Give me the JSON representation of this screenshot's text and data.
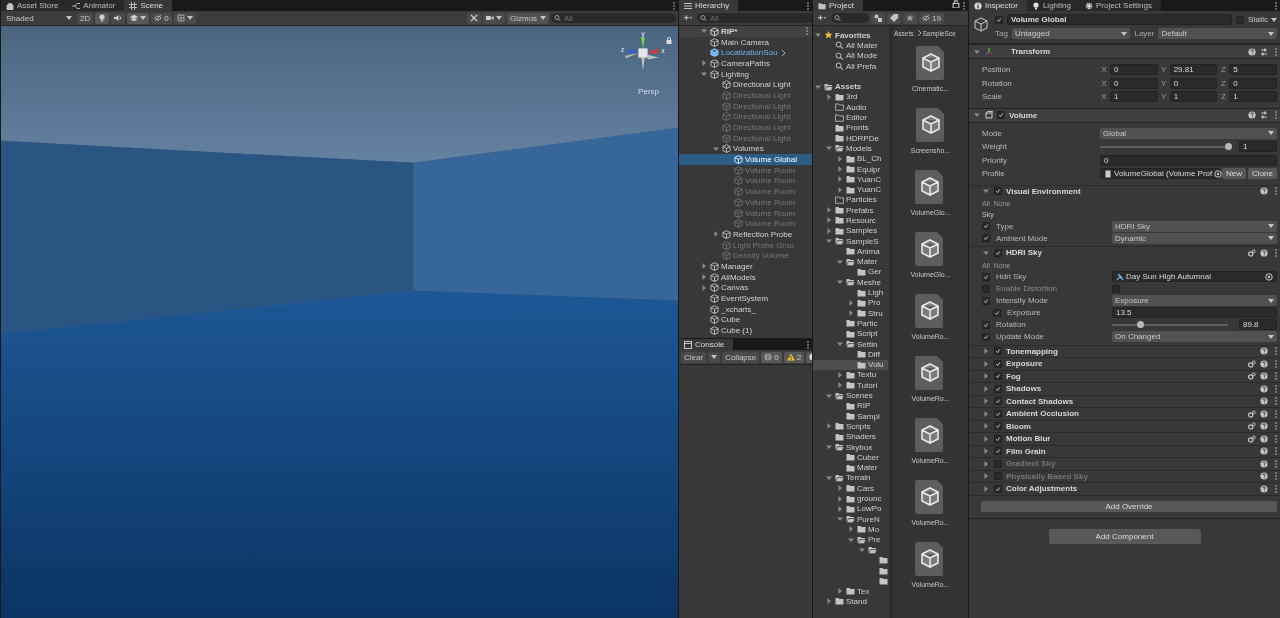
{
  "scene": {
    "tabs": [
      {
        "label": "Asset Store",
        "selected": false
      },
      {
        "label": "Animator",
        "selected": false
      },
      {
        "label": "Scene",
        "selected": true
      }
    ],
    "toolbar": {
      "shading": "Shaded",
      "mode_2d": "2D",
      "hidden_count": "0",
      "gizmos": "Gizmos",
      "search_placeholder": "All"
    },
    "gizmo": {
      "axes": [
        "y",
        "z",
        "x"
      ],
      "projection": "Persp"
    }
  },
  "hierarchy": {
    "title": "Hierarchy",
    "search_placeholder": "All",
    "scene": {
      "label": "RIP*",
      "expanded": true
    },
    "items": [
      {
        "label": "Main Camera",
        "kind": "object",
        "active": true,
        "selected": false
      },
      {
        "label": "LocalizationSou",
        "kind": "prefab",
        "active": true,
        "selected": false
      },
      {
        "label": "CameraPaths",
        "kind": "object",
        "active": true,
        "selected": false,
        "expanded": false
      },
      {
        "label": "Lighting",
        "kind": "object",
        "active": true,
        "selected": false,
        "expanded": true,
        "children": [
          {
            "label": "Directional Light",
            "kind": "object",
            "active": true,
            "selected": false
          },
          {
            "label": "Directional Light",
            "kind": "object",
            "active": false,
            "selected": false
          },
          {
            "label": "Directional Light",
            "kind": "object",
            "active": false,
            "selected": false
          },
          {
            "label": "Directional Light",
            "kind": "object",
            "active": false,
            "selected": false
          },
          {
            "label": "Directional Light",
            "kind": "object",
            "active": false,
            "selected": false
          },
          {
            "label": "Directional Light",
            "kind": "object",
            "active": false,
            "selected": false
          },
          {
            "label": "Volumes",
            "kind": "object",
            "active": true,
            "selected": false,
            "expanded": true,
            "children": [
              {
                "label": "Volume Global",
                "kind": "object",
                "active": true,
                "selected": true
              },
              {
                "label": "Volume Room",
                "kind": "object",
                "active": false,
                "selected": false
              },
              {
                "label": "Volume Room",
                "kind": "object",
                "active": false,
                "selected": false
              },
              {
                "label": "Volume Room",
                "kind": "object",
                "active": false,
                "selected": false
              },
              {
                "label": "Volume Room",
                "kind": "object",
                "active": false,
                "selected": false
              },
              {
                "label": "Volume Room",
                "kind": "object",
                "active": false,
                "selected": false
              },
              {
                "label": "Volume Room",
                "kind": "object",
                "active": false,
                "selected": false
              }
            ]
          },
          {
            "label": "Reflection Probe",
            "kind": "object",
            "active": true,
            "selected": false,
            "expanded": false
          },
          {
            "label": "Light Probe Grou",
            "kind": "object",
            "active": false,
            "selected": false
          },
          {
            "label": "Density Volume",
            "kind": "object",
            "active": false,
            "selected": false
          }
        ]
      },
      {
        "label": "Manager",
        "kind": "object",
        "active": true,
        "selected": false,
        "expanded": false
      },
      {
        "label": "AllModels",
        "kind": "object",
        "active": true,
        "selected": false,
        "expanded": false
      },
      {
        "label": "Canvas",
        "kind": "object",
        "active": true,
        "selected": false,
        "expanded": false
      },
      {
        "label": "EventSystem",
        "kind": "object",
        "active": true,
        "selected": false
      },
      {
        "label": "_xcharts_",
        "kind": "object",
        "active": true,
        "selected": false
      },
      {
        "label": "Cube",
        "kind": "object",
        "active": true,
        "selected": false
      },
      {
        "label": "Cube (1)",
        "kind": "object",
        "active": true,
        "selected": false
      }
    ]
  },
  "console": {
    "title": "Console",
    "clear": "Clear",
    "collapse": "Collapse",
    "errors": "0",
    "warnings": "2"
  },
  "project": {
    "title": "Project",
    "hidden_count": "19",
    "breadcrumb": [
      "Assets",
      "SampleSce"
    ],
    "tree": [
      {
        "label": "Favorites",
        "kind": "favorites",
        "selected": false,
        "expanded": true,
        "children": [
          {
            "label": "All Mater",
            "kind": "search",
            "selected": false
          },
          {
            "label": "All Mode",
            "kind": "search",
            "selected": false
          },
          {
            "label": "All Prefa",
            "kind": "search",
            "selected": false
          }
        ]
      },
      {
        "label": "Assets",
        "kind": "folder",
        "selected": false,
        "expanded": true,
        "children": [
          {
            "label": "3rd",
            "kind": "folder",
            "selected": false,
            "expanded": false
          },
          {
            "label": "Audio",
            "kind": "empty-folder",
            "selected": false
          },
          {
            "label": "Editor",
            "kind": "empty-folder",
            "selected": false
          },
          {
            "label": "Fronts",
            "kind": "folder",
            "selected": false
          },
          {
            "label": "HDRPDe",
            "kind": "folder",
            "selected": false
          },
          {
            "label": "Models",
            "kind": "folder",
            "selected": false,
            "expanded": true,
            "children": [
              {
                "label": "BL_Ch",
                "kind": "folder",
                "selected": false,
                "expanded": false
              },
              {
                "label": "Equipr",
                "kind": "folder",
                "selected": false,
                "expanded": false
              },
              {
                "label": "YuanC",
                "kind": "folder",
                "selected": false,
                "expanded": false
              },
              {
                "label": "YuanC",
                "kind": "folder",
                "selected": false,
                "expanded": false
              }
            ]
          },
          {
            "label": "Particles",
            "kind": "empty-folder",
            "selected": false
          },
          {
            "label": "Prefabs",
            "kind": "folder",
            "selected": false,
            "expanded": false
          },
          {
            "label": "Resourc",
            "kind": "folder",
            "selected": false,
            "expanded": false
          },
          {
            "label": "Samples",
            "kind": "folder",
            "selected": false,
            "expanded": false
          },
          {
            "label": "SampleS",
            "kind": "folder",
            "selected": false,
            "expanded": true,
            "children": [
              {
                "label": "Anima",
                "kind": "folder",
                "selected": false
              },
              {
                "label": "Mater",
                "kind": "folder",
                "selected": false,
                "expanded": true,
                "children": [
                  {
                    "label": "Ger",
                    "kind": "folder",
                    "selected": false
                  }
                ]
              },
              {
                "label": "Meshe",
                "kind": "folder",
                "selected": false,
                "expanded": true,
                "children": [
                  {
                    "label": "Ligh",
                    "kind": "folder",
                    "selected": false
                  },
                  {
                    "label": "Pro",
                    "kind": "folder",
                    "selected": false,
                    "expanded": false
                  },
                  {
                    "label": "Stru",
                    "kind": "folder",
                    "selected": false,
                    "expanded": false
                  }
                ]
              },
              {
                "label": "Partic",
                "kind": "folder",
                "selected": false
              },
              {
                "label": "Script",
                "kind": "folder",
                "selected": false
              },
              {
                "label": "Settin",
                "kind": "folder",
                "selected": false,
                "expanded": true,
                "children": [
                  {
                    "label": "Diff",
                    "kind": "folder",
                    "selected": false
                  },
                  {
                    "label": "Volu",
                    "kind": "folder",
                    "selected": true
                  }
                ]
              },
              {
                "label": "Textu",
                "kind": "folder",
                "selected": false,
                "expanded": false
              },
              {
                "label": "Tutori",
                "kind": "folder",
                "selected": false,
                "expanded": false
              }
            ]
          },
          {
            "label": "Scenes",
            "kind": "folder",
            "selected": false,
            "expanded": true,
            "children": [
              {
                "label": "RIP",
                "kind": "folder",
                "selected": false
              },
              {
                "label": "Sampl",
                "kind": "folder",
                "selected": false
              }
            ]
          },
          {
            "label": "Scripts",
            "kind": "folder",
            "selected": false,
            "expanded": false
          },
          {
            "label": "Shaders",
            "kind": "folder",
            "selected": false
          },
          {
            "label": "Skybox",
            "kind": "folder",
            "selected": false,
            "expanded": true,
            "children": [
              {
                "label": "Cuber",
                "kind": "folder",
                "selected": false
              },
              {
                "label": "Mater",
                "kind": "folder",
                "selected": false
              }
            ]
          },
          {
            "label": "Terrain",
            "kind": "folder",
            "selected": false,
            "expanded": true,
            "children": [
              {
                "label": "Cars",
                "kind": "folder",
                "selected": false,
                "expanded": false
              },
              {
                "label": "grounc",
                "kind": "folder",
                "selected": false,
                "expanded": false
              },
              {
                "label": "LowPo",
                "kind": "folder",
                "selected": false,
                "expanded": false
              },
              {
                "label": "PureN",
                "kind": "folder",
                "selected": false,
                "expanded": true,
                "children": [
                  {
                    "label": "Mo",
                    "kind": "folder",
                    "selected": false,
                    "expanded": false
                  },
                  {
                    "label": "Pre",
                    "kind": "folder",
                    "selected": false,
                    "expanded": true,
                    "children": [
                      {
                        "kind": "folder",
                        "selected": false,
                        "expanded": true,
                        "children": [
                          {
                            "kind": "folder",
                            "selected": false
                          },
                          {
                            "kind": "folder",
                            "selected": false
                          },
                          {
                            "kind": "folder",
                            "selected": false
                          }
                        ]
                      }
                    ]
                  }
                ]
              },
              {
                "label": "Tex",
                "kind": "folder",
                "selected": false,
                "expanded": false
              }
            ]
          },
          {
            "label": "Stand",
            "kind": "folder",
            "selected": false,
            "expanded": false
          }
        ]
      }
    ],
    "assets": [
      "Cinematic...",
      "Screensho...",
      "VolumeGlo...",
      "VolumeGlo...",
      "VolumeRo...",
      "VolumeRo...",
      "VolumeRo...",
      "VolumeRo...",
      "VolumeRo..."
    ]
  },
  "inspector": {
    "tabs": [
      {
        "label": "Inspector",
        "selected": true
      },
      {
        "label": "Lighting",
        "selected": false
      },
      {
        "label": "Project Settings",
        "selected": false
      }
    ],
    "object": {
      "name": "Volume Global",
      "active": true,
      "static_label": "Static",
      "static": false,
      "tag_label": "Tag",
      "tag": "Untagged",
      "layer_label": "Layer",
      "layer": "Default"
    },
    "transform": {
      "title": "Transform",
      "expanded": true,
      "fields": [
        {
          "label": "Position",
          "values": [
            {
              "axis": "X",
              "value": "0"
            },
            {
              "axis": "Y",
              "value": "29.81"
            },
            {
              "axis": "Z",
              "value": "5"
            }
          ]
        },
        {
          "label": "Rotation",
          "values": [
            {
              "axis": "X",
              "value": "0"
            },
            {
              "axis": "Y",
              "value": "0"
            },
            {
              "axis": "Z",
              "value": "0"
            }
          ]
        },
        {
          "label": "Scale",
          "values": [
            {
              "axis": "X",
              "value": "1"
            },
            {
              "axis": "Y",
              "value": "1"
            },
            {
              "axis": "Z",
              "value": "1"
            }
          ]
        }
      ]
    },
    "volume": {
      "title": "Volume",
      "enabled": true,
      "expanded": true,
      "mode_label": "Mode",
      "mode": "Global",
      "weight_label": "Weight",
      "weight": {
        "level": 1,
        "reading": "1"
      },
      "priority_label": "Priority",
      "priority": "0",
      "profile_label": "Profile",
      "profile": "VolumeGlobal (Volume Prof",
      "buttons": [
        "New",
        "Clone"
      ]
    },
    "overrides": [
      {
        "title": "Visual Environment",
        "checked": true,
        "expanded": true,
        "kind": "plain",
        "all": "All",
        "none": "None",
        "section": "Sky",
        "properties": [
          {
            "kind": "dropdown",
            "label": "Type",
            "override": true,
            "value": "HDRI Sky"
          },
          {
            "kind": "dropdown",
            "label": "Ambient Mode",
            "override": true,
            "value": "Dynamic"
          }
        ]
      },
      {
        "title": "HDRI Sky",
        "checked": true,
        "expanded": true,
        "kind": "preset",
        "all": "All",
        "none": "None",
        "properties": [
          {
            "kind": "object",
            "label": "Hdri Sky",
            "override": true,
            "value": "Day Sun High Autumnal"
          },
          {
            "kind": "toggle",
            "label": "Enable Distortion",
            "override": false,
            "checked": false
          },
          {
            "kind": "dropdown",
            "label": "Intensity Mode",
            "override": true,
            "value": "Exposure",
            "children": [
              {
                "kind": "text",
                "label": "Exposure",
                "override": true,
                "value": "13.5"
              }
            ]
          },
          {
            "kind": "slider",
            "label": "Rotation",
            "override": true,
            "level": 0.25,
            "reading": "89.8"
          },
          {
            "kind": "dropdown",
            "label": "Update Mode",
            "override": true,
            "value": "On Changed"
          }
        ]
      },
      {
        "title": "Tonemapping",
        "checked": true,
        "expanded": false,
        "kind": "plain"
      },
      {
        "title": "Exposure",
        "checked": true,
        "expanded": false,
        "kind": "preset"
      },
      {
        "title": "Fog",
        "checked": true,
        "expanded": false,
        "kind": "preset"
      },
      {
        "title": "Shadows",
        "checked": true,
        "expanded": false,
        "kind": "plain"
      },
      {
        "title": "Contact Shadows",
        "checked": true,
        "expanded": false,
        "kind": "plain"
      },
      {
        "title": "Ambient Occlusion",
        "checked": true,
        "expanded": false,
        "kind": "preset"
      },
      {
        "title": "Bloom",
        "checked": true,
        "expanded": false,
        "kind": "preset"
      },
      {
        "title": "Motion Blur",
        "checked": true,
        "expanded": false,
        "kind": "preset"
      },
      {
        "title": "Film Grain",
        "checked": true,
        "expanded": false,
        "kind": "plain"
      },
      {
        "title": "Gradient Sky",
        "checked": false,
        "expanded": false,
        "kind": "plain"
      },
      {
        "title": "Physically Based Sky",
        "checked": false,
        "expanded": false,
        "kind": "plain"
      },
      {
        "title": "Color Adjustments",
        "checked": true,
        "expanded": false,
        "kind": "plain"
      }
    ],
    "add_override": "Add Override",
    "add_component": "Add Component"
  }
}
